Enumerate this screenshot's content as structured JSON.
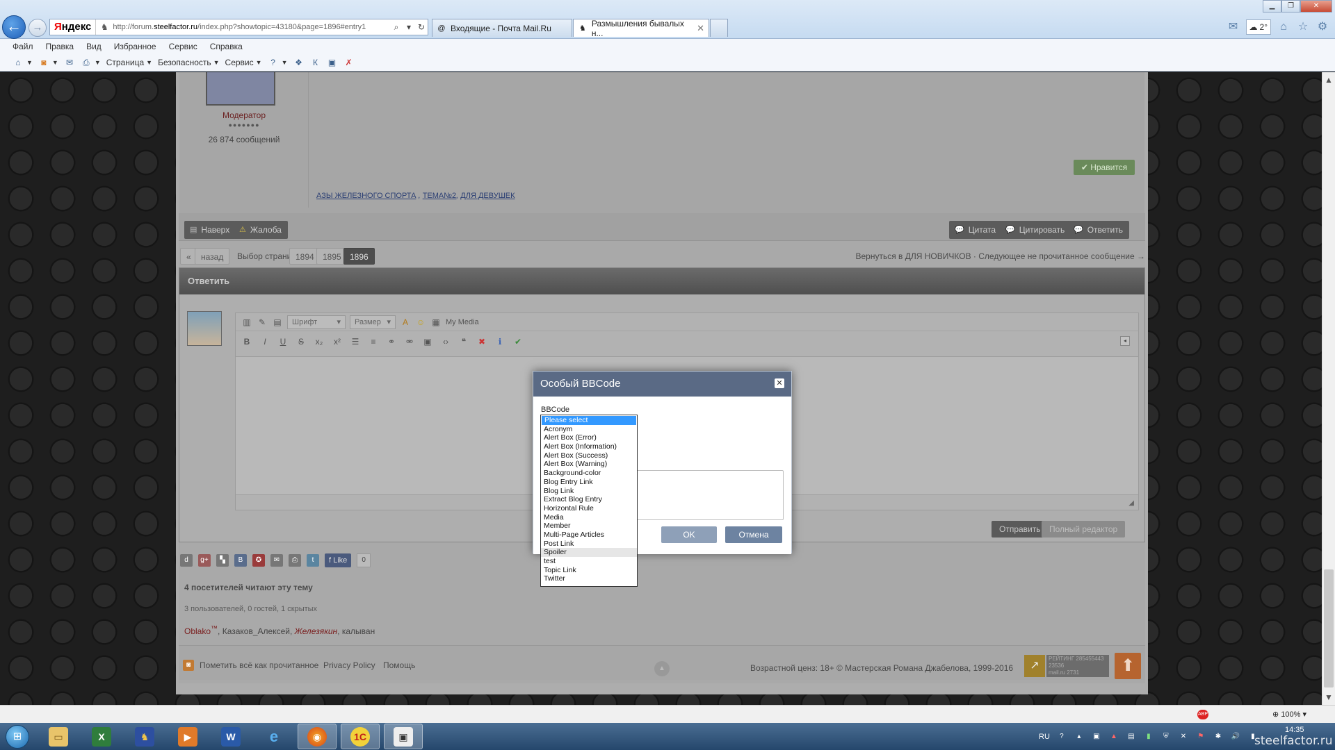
{
  "browser": {
    "search_brand": [
      "Я",
      "ндекс"
    ],
    "url_host": "http://forum.",
    "url_domain": "steelfactor.ru",
    "url_path": "/index.php?showtopic=43180&page=1896#entry1",
    "tabs": [
      {
        "label": "Входящие - Почта Mail.Ru"
      },
      {
        "label": "Размышления бывалых н..."
      }
    ],
    "weather": "2°",
    "menu": [
      "Файл",
      "Правка",
      "Вид",
      "Избранное",
      "Сервис",
      "Справка"
    ],
    "commands": {
      "page": "Страница",
      "safety": "Безопасность",
      "tools": "Сервис"
    }
  },
  "post": {
    "author_role": "Модератор",
    "author_dots": "●●●●●●●",
    "author_posts": "26 874 сообщений",
    "like_label": "Нравится",
    "tags": [
      "АЗЫ ЖЕЛЕЗНОГО СПОРТА",
      "ТЕМА№2",
      "ДЛЯ ДЕВУШЕК"
    ],
    "tag_sep": ",",
    "actions": {
      "top": "Наверх",
      "report": "Жалоба",
      "quote": "Цитата",
      "multiquote": "Цитировать",
      "reply": "Ответить"
    }
  },
  "pager": {
    "prev_symbol": "«",
    "back": "назад",
    "label": "Выбор страницы",
    "pages": [
      "1894",
      "1895",
      "1896"
    ],
    "right_text": "Вернуться в ДЛЯ НОВИЧКОВ · Следующее не прочитанное сообщение →"
  },
  "reply": {
    "title": "Ответить",
    "font_placeholder": "Шрифт",
    "size_placeholder": "Размер",
    "my_media": "My Media",
    "send": "Отправить",
    "full_editor": "Полный редактор"
  },
  "share": {
    "fb_like": "Like",
    "fb_count": "0"
  },
  "online": {
    "title": "4 посетителей читают эту тему",
    "counts": "3 пользователей, 0 гостей, 1 скрытых",
    "users": [
      {
        "name": "Oblako",
        "suffix": "™",
        "style": "red"
      },
      {
        "name": "Казаков_Алексей",
        "style": "normal"
      },
      {
        "name": "Железякин",
        "style": "italic"
      },
      {
        "name": "калыван",
        "style": "normal"
      }
    ]
  },
  "footer": {
    "mark_read": "Пометить всё как прочитанное",
    "privacy": "Privacy Policy",
    "help": "Помощь",
    "age": "Возрастной ценз: 18+",
    "copyright": "© Мастерская Романа Джабелова, 1999-2016",
    "rating_lines": [
      "РЕЙТИНГ 285455443",
      "23536",
      "mail.ru 2731"
    ]
  },
  "modal": {
    "title": "Особый BBCode",
    "field_label": "BBCode",
    "ok": "OK",
    "cancel": "Отмена",
    "options": [
      "Please select",
      "Acronym",
      "Alert Box (Error)",
      "Alert Box (Information)",
      "Alert Box (Success)",
      "Alert Box (Warning)",
      "Background-color",
      "Blog Entry Link",
      "Blog Link",
      "Extract Blog Entry",
      "Horizontal Rule",
      "Media",
      "Member",
      "Multi-Page Articles",
      "Post Link",
      "Spoiler",
      "test",
      "Topic Link",
      "Twitter"
    ],
    "selected_index": 0,
    "hover_index": 15
  },
  "status": {
    "zoom": "100%",
    "abp": "ABP"
  },
  "taskbar": {
    "lang": "RU",
    "clock": "14:35",
    "watermark": "steelfactor.ru"
  }
}
